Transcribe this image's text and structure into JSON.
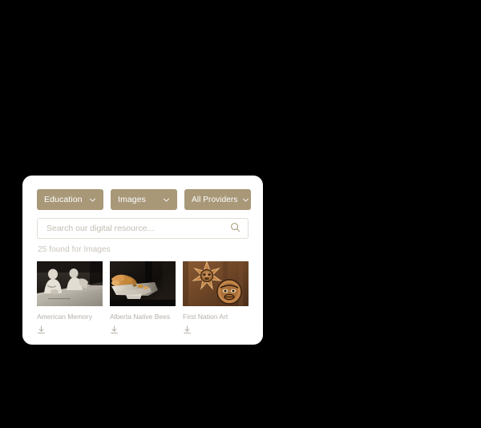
{
  "panel": {
    "name": "digital-resource-search-widget"
  },
  "filters": [
    {
      "id": "education",
      "label": "Education",
      "icon": "chevron-down-icon"
    },
    {
      "id": "images",
      "label": "Images",
      "icon": "chevron-down-icon"
    },
    {
      "id": "providers",
      "label": "All Providers",
      "icon": "chevron-down-icon"
    }
  ],
  "search": {
    "placeholder": "Search our digital resource...",
    "value": "",
    "icon": "search-icon"
  },
  "results": {
    "count_text": "25 found for Images",
    "items": [
      {
        "title": "American Memory",
        "thumb": "archival-black-and-white-photo-two-people-at-table",
        "download_icon": "download-icon"
      },
      {
        "title": "Alberta Native Bees",
        "thumb": "dark-photo-of-bees-on-honeycomb-tray",
        "download_icon": "download-icon"
      },
      {
        "title": "First Nation Art",
        "thumb": "carved-indigenous-masks-warm-brown-tones",
        "download_icon": "download-icon"
      }
    ]
  },
  "colors": {
    "background": "#000000",
    "panel": "#ffffff",
    "accent": "#a89878",
    "accent_text": "#ffffff",
    "input_border": "#e2ded6",
    "placeholder_text": "#c3bcb2",
    "muted_text": "#c9c4bc",
    "title_text": "#b5b0a8"
  }
}
